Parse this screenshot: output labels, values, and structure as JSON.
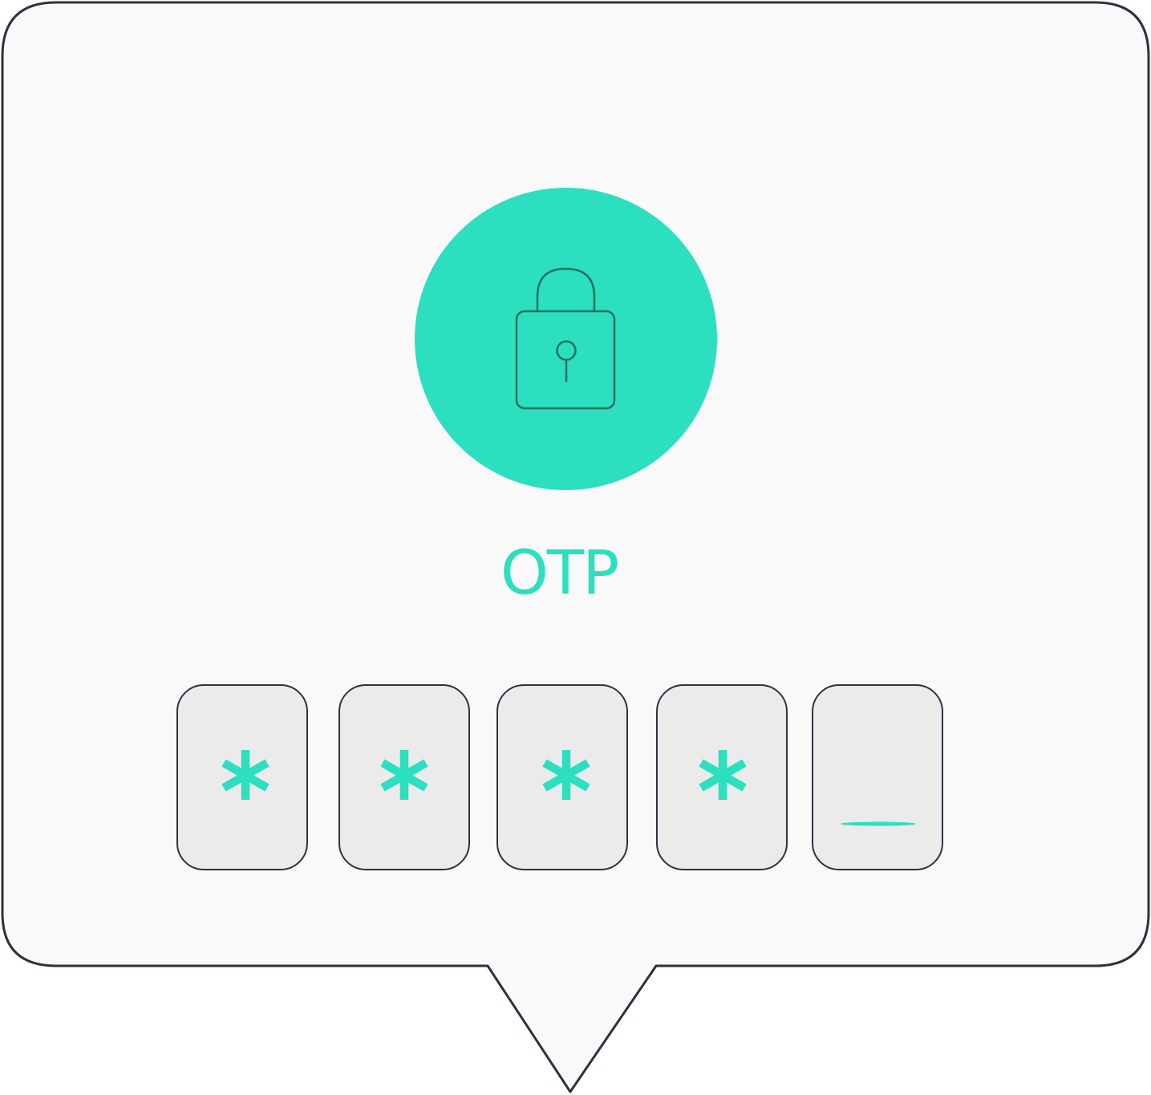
{
  "dialog": {
    "title": "OTP"
  },
  "otp_input": {
    "digits": [
      "*",
      "*",
      "*",
      "*",
      ""
    ],
    "filled_count": 4,
    "total_count": 5,
    "active_index": 4
  },
  "icons": {
    "lock": "lock-icon",
    "masked_digit": "asterisk-icon",
    "cursor": "cursor-underline"
  },
  "colors": {
    "accent": "#2bdfbf",
    "outline": "#2a3440",
    "bubble_fill": "#f9f9f9",
    "box_fill": "#ebebeb"
  }
}
